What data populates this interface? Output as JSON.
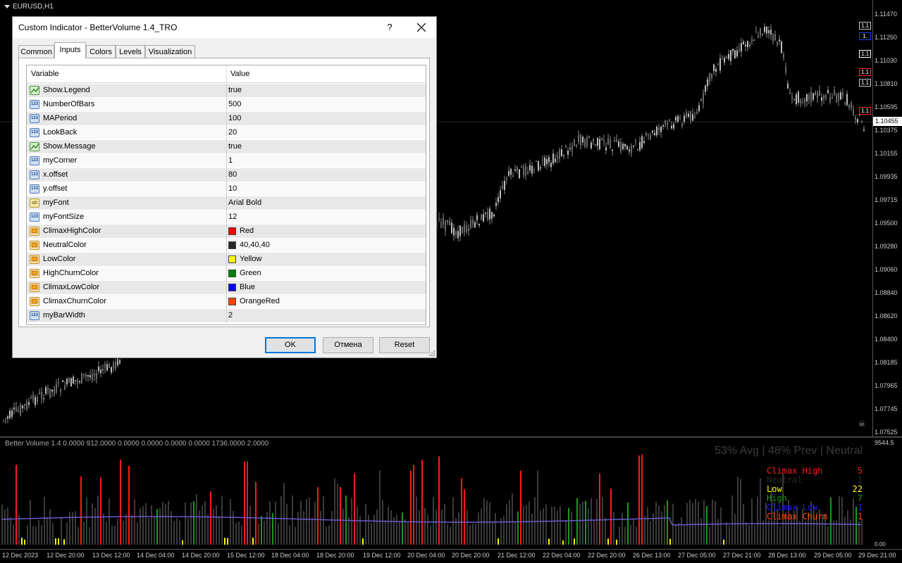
{
  "chart": {
    "symbol": "EURUSD,H1",
    "current_price": "1.10455",
    "price_ticks": [
      "1.11470",
      "1.11250",
      "1.11030",
      "1.10810",
      "1.10595",
      "1.10375",
      "1.10155",
      "1.09935",
      "1.09715",
      "1.09500",
      "1.09280",
      "1.09060",
      "1.08840",
      "1.08620",
      "1.08400",
      "1.08185",
      "1.07965",
      "1.07745",
      "1.07525"
    ],
    "hline_tags": [
      {
        "text": "1.1",
        "color": "#c8c8c8"
      },
      {
        "text": "1.",
        "color": "#2040ff"
      },
      {
        "text": "1.1",
        "color": "#ffffff"
      },
      {
        "text": "1.1",
        "color": "#ff2a2a"
      },
      {
        "text": "1.1",
        "color": "#c8c8c8"
      },
      {
        "text": "1.1",
        "color": "#ff2a2a"
      }
    ]
  },
  "indicator": {
    "title": "Better Volume 1.4 0.0000 912.0000 0.0000 0.0000 0.0000 0.0000 1736.0000 2.0000",
    "max_label": "9544.5",
    "zero_label": "0.00",
    "message": "53% Avg | 48% Prev | Neutral",
    "legend": [
      {
        "label": "Climax High",
        "count": "5",
        "color": "#ff1a1a"
      },
      {
        "label": "Neutral",
        "count": "1",
        "color": "#282828"
      },
      {
        "label": "Low",
        "count": "22",
        "color": "#ffff00"
      },
      {
        "label": "High",
        "count": "7",
        "color": "#1a9a1a"
      },
      {
        "label": "Climax Low",
        "count": "1",
        "color": "#1a1aff"
      },
      {
        "label": "Climax Churn",
        "count": "1",
        "color": "#ff4500"
      }
    ]
  },
  "time_axis": [
    "12 Dec 2023",
    "12 Dec 20:00",
    "13 Dec 12:00",
    "14 Dec 04:00",
    "14 Dec 20:00",
    "15 Dec 12:00",
    "18 Dec 04:00",
    "18 Dec 20:00",
    "19 Dec 12:00",
    "20 Dec 04:00",
    "20 Dec 20:00",
    "21 Dec 12:00",
    "22 Dec 04:00",
    "22 Dec 20:00",
    "26 Dec 13:00",
    "27 Dec 05:00",
    "27 Dec 21:00",
    "28 Dec 13:00",
    "29 Dec 05:00",
    "29 Dec 21:00"
  ],
  "dialog": {
    "title": "Custom Indicator - BetterVolume 1.4_TRO",
    "help": "?",
    "tabs": [
      "Common",
      "Inputs",
      "Colors",
      "Levels",
      "Visualization"
    ],
    "active_tab": "Inputs",
    "columns": {
      "variable": "Variable",
      "value": "Value"
    },
    "rows": [
      {
        "name": "Show.Legend",
        "value": "true",
        "type": "bool"
      },
      {
        "name": "NumberOfBars",
        "value": "500",
        "type": "int"
      },
      {
        "name": "MAPeriod",
        "value": "100",
        "type": "int"
      },
      {
        "name": "LookBack",
        "value": "20",
        "type": "int"
      },
      {
        "name": "Show.Message",
        "value": "true",
        "type": "bool"
      },
      {
        "name": "myCorner",
        "value": "1",
        "type": "int"
      },
      {
        "name": "x.offset",
        "value": "80",
        "type": "int"
      },
      {
        "name": "y.offset",
        "value": "10",
        "type": "int"
      },
      {
        "name": "myFont",
        "value": "Arial Bold",
        "type": "string"
      },
      {
        "name": "myFontSize",
        "value": "12",
        "type": "int"
      },
      {
        "name": "ClimaxHighColor",
        "value": "Red",
        "type": "color",
        "swatch": "#ff0000"
      },
      {
        "name": "NeutralColor",
        "value": "40,40,40",
        "type": "color",
        "swatch": "#282828"
      },
      {
        "name": "LowColor",
        "value": "Yellow",
        "type": "color",
        "swatch": "#ffff00"
      },
      {
        "name": "HighChurnColor",
        "value": "Green",
        "type": "color",
        "swatch": "#008000"
      },
      {
        "name": "ClimaxLowColor",
        "value": "Blue",
        "type": "color",
        "swatch": "#0000ff"
      },
      {
        "name": "ClimaxChurnColor",
        "value": "OrangeRed",
        "type": "color",
        "swatch": "#ff4500"
      },
      {
        "name": "myBarWidth",
        "value": "2",
        "type": "int"
      }
    ],
    "buttons": {
      "ok": "OK",
      "cancel": "Отмена",
      "reset": "Reset"
    }
  }
}
